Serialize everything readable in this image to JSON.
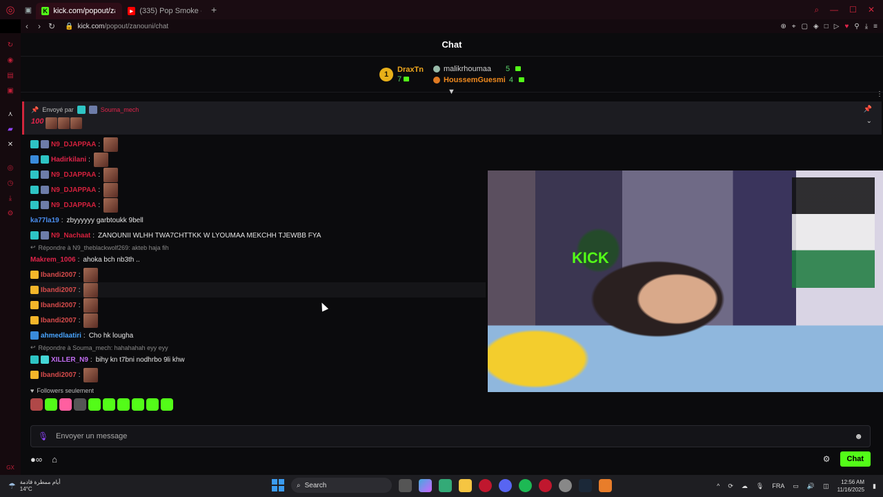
{
  "browser": {
    "tabs": [
      {
        "title": "kick.com/popout/zanouni",
        "active": true
      },
      {
        "title": "(335) Pop Smoke - Get Ba",
        "active": false
      }
    ],
    "url_host": "kick.com",
    "url_path": "/popout/zanouni/chat"
  },
  "chat": {
    "title": "Chat",
    "leaderboard": {
      "first": {
        "rank": "1",
        "name": "DraxTn",
        "count": "7"
      },
      "others": [
        {
          "name": "malikrhoumaa",
          "count": "5"
        },
        {
          "name": "HoussemGuesmi",
          "count": "4"
        }
      ]
    },
    "pinned": {
      "label": "Envoyé par",
      "user": "Souma_mech",
      "emote_text": "100"
    },
    "messages": [
      {
        "user": "N9_DJAPPAA",
        "color": "red",
        "badges": [
          "cyan",
          "knight"
        ],
        "text": "",
        "emote": true
      },
      {
        "user": "Hadirkilani",
        "color": "crimson",
        "badges": [
          "blue",
          "cyan"
        ],
        "text": "",
        "emote": true
      },
      {
        "user": "N9_DJAPPAA",
        "color": "red",
        "badges": [
          "cyan",
          "knight"
        ],
        "text": "",
        "emote": true
      },
      {
        "user": "N9_DJAPPAA",
        "color": "red",
        "badges": [
          "cyan",
          "knight"
        ],
        "text": "",
        "emote": true
      },
      {
        "user": "N9_DJAPPAA",
        "color": "red",
        "badges": [
          "cyan",
          "knight"
        ],
        "text": "",
        "emote": true
      },
      {
        "user": "ka77la19",
        "color": "blue",
        "badges": [],
        "text": "zbyyyyyy garbtoukk 9bell",
        "emote": false
      },
      {
        "user": "N9_Nachaat",
        "color": "red",
        "badges": [
          "cyan",
          "knight"
        ],
        "text": "ZANOUNII WLHH TWA7CHTTKK W LYOUMAA MEKCHH TJEWBB FYA",
        "emote": false
      },
      {
        "reply": "Répondre à N9_theblackwolf269: akteb haja fih"
      },
      {
        "user": "Makrem_1006",
        "color": "crimson",
        "badges": [],
        "text": "ahoka bch nb3th ..",
        "emote": false
      },
      {
        "user": "Ibandi2007",
        "color": "gold",
        "badges": [
          "gold"
        ],
        "text": "",
        "emote": true
      },
      {
        "user": "Ibandi2007",
        "color": "gold",
        "badges": [
          "gold"
        ],
        "text": "",
        "emote": true,
        "highlight": true
      },
      {
        "user": "Ibandi2007",
        "color": "gold",
        "badges": [
          "gold"
        ],
        "text": "",
        "emote": true
      },
      {
        "user": "Ibandi2007",
        "color": "gold",
        "badges": [
          "gold"
        ],
        "text": "",
        "emote": true
      },
      {
        "user": "ahmedlaatiri",
        "color": "ltblue",
        "badges": [
          "blue"
        ],
        "text": "Cho hk lougha",
        "emote": false
      },
      {
        "reply": "Répondre à Souma_mech: hahahahah eyy eyy"
      },
      {
        "user": "XILLER_N9",
        "color": "purple",
        "badges": [
          "cyan",
          "sub"
        ],
        "text": "bihy kn t7bni nodhrbo 9li khw",
        "emote": false
      },
      {
        "user": "Ibandi2007",
        "color": "gold",
        "badges": [
          "gold"
        ],
        "text": "",
        "emote": true
      }
    ],
    "followers_only": "Followers seulement",
    "composer_placeholder": "Envoyer un message",
    "send_label": "Chat"
  },
  "taskbar": {
    "weather_title": "أيام ممطرة قادمة",
    "weather_temp": "14°C",
    "search_label": "Search",
    "lang": "FRA",
    "time": "12:56 AM",
    "date": "11/16/2025"
  },
  "colors": {
    "kick_green": "#53fc18",
    "opera_red": "#d2263c"
  }
}
